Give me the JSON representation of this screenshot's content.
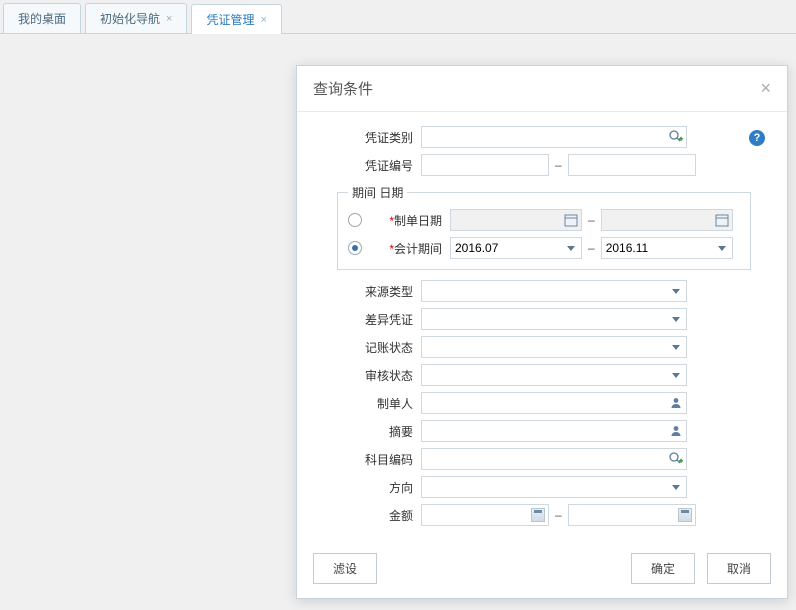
{
  "tabs": {
    "desktop": "我的桌面",
    "initNav": "初始化导航",
    "voucher": "凭证管理"
  },
  "dialog": {
    "title": "查询条件",
    "close": "×",
    "help": "?"
  },
  "labels": {
    "voucherType": "凭证类别",
    "voucherNo": "凭证编号",
    "periodDate": "期间 日期",
    "makeDate": "制单日期",
    "acctPeriod": "会计期间",
    "sourceType": "来源类型",
    "diffVoucher": "差异凭证",
    "postStatus": "记账状态",
    "auditStatus": "审核状态",
    "maker": "制单人",
    "summary": "摘要",
    "subjectCode": "科目编码",
    "direction": "方向",
    "amount": "金额"
  },
  "values": {
    "voucherType": "",
    "voucherNoFrom": "",
    "voucherNoTo": "",
    "dateFrom": "",
    "dateTo": "",
    "periodFrom": "2016.07",
    "periodTo": "2016.11",
    "sourceType": "",
    "diffVoucher": "",
    "postStatus": "",
    "auditStatus": "",
    "maker": "",
    "summary": "",
    "subjectCode": "",
    "direction": "",
    "amountFrom": "",
    "amountTo": ""
  },
  "radios": {
    "byDate": false,
    "byPeriod": true
  },
  "asterisk": "*",
  "dash": "–",
  "buttons": {
    "filter": "滤设",
    "ok": "确定",
    "cancel": "取消"
  }
}
